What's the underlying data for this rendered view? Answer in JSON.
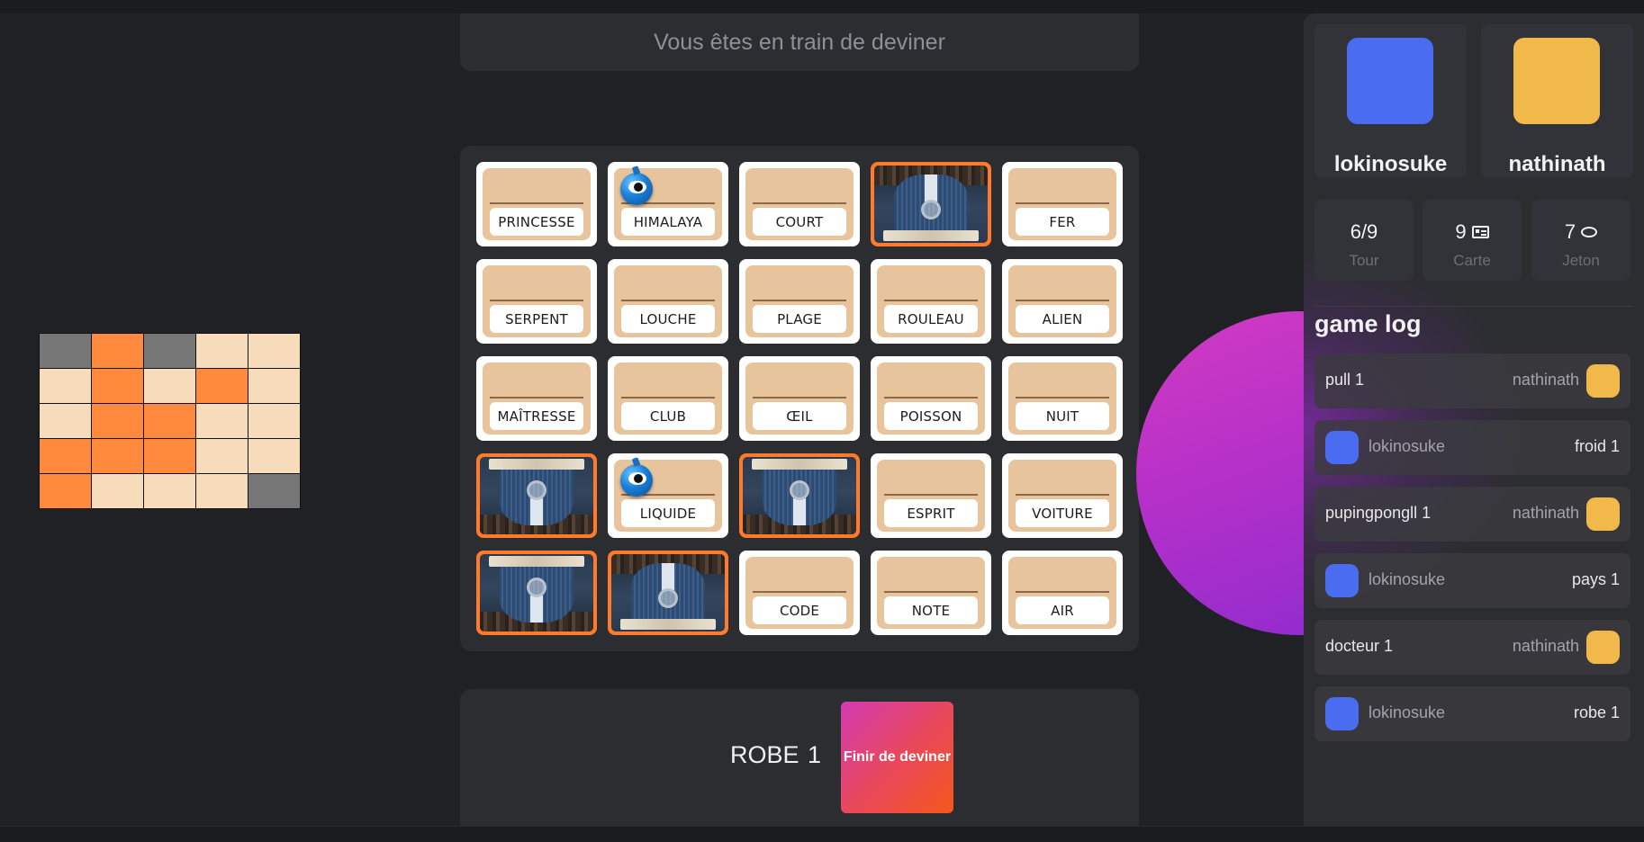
{
  "status": {
    "text": "Vous êtes en train de deviner"
  },
  "colors": {
    "orange": "#ff8a3d",
    "beige": "#f6dcbb",
    "gray": "#777777",
    "blue_team": "#4a6cf0",
    "yellow_team": "#f1b94a",
    "accent_gradient": [
      "#d23bb2",
      "#f4571c"
    ],
    "purple": "#b430c8"
  },
  "key_map": {
    "rows": [
      [
        "gray",
        "orange",
        "gray",
        "beige",
        "beige"
      ],
      [
        "beige",
        "orange",
        "beige",
        "orange",
        "beige"
      ],
      [
        "beige",
        "orange",
        "orange",
        "beige",
        "beige"
      ],
      [
        "orange",
        "orange",
        "orange",
        "beige",
        "beige"
      ],
      [
        "orange",
        "beige",
        "beige",
        "beige",
        "gray"
      ]
    ]
  },
  "board": {
    "cards": [
      {
        "word": "PRINCESSE",
        "state": "hidden",
        "marked": false
      },
      {
        "word": "HIMALAYA",
        "state": "hidden",
        "marked": true
      },
      {
        "word": "COURT",
        "state": "hidden",
        "marked": false
      },
      {
        "word": "",
        "state": "revealed",
        "marked": false,
        "flip": false
      },
      {
        "word": "FER",
        "state": "hidden",
        "marked": false
      },
      {
        "word": "SERPENT",
        "state": "hidden",
        "marked": false
      },
      {
        "word": "LOUCHE",
        "state": "hidden",
        "marked": false
      },
      {
        "word": "PLAGE",
        "state": "hidden",
        "marked": false
      },
      {
        "word": "ROULEAU",
        "state": "hidden",
        "marked": false
      },
      {
        "word": "ALIEN",
        "state": "hidden",
        "marked": false
      },
      {
        "word": "MAÎTRESSE",
        "state": "hidden",
        "marked": false
      },
      {
        "word": "CLUB",
        "state": "hidden",
        "marked": false
      },
      {
        "word": "ŒIL",
        "state": "hidden",
        "marked": false
      },
      {
        "word": "POISSON",
        "state": "hidden",
        "marked": false
      },
      {
        "word": "NUIT",
        "state": "hidden",
        "marked": false
      },
      {
        "word": "",
        "state": "revealed",
        "marked": false,
        "flip": true
      },
      {
        "word": "LIQUIDE",
        "state": "hidden",
        "marked": true
      },
      {
        "word": "",
        "state": "revealed",
        "marked": false,
        "flip": true
      },
      {
        "word": "ESPRIT",
        "state": "hidden",
        "marked": false
      },
      {
        "word": "VOITURE",
        "state": "hidden",
        "marked": false
      },
      {
        "word": "",
        "state": "revealed",
        "marked": false,
        "flip": true
      },
      {
        "word": "",
        "state": "revealed",
        "marked": false,
        "flip": false
      },
      {
        "word": "CODE",
        "state": "hidden",
        "marked": false
      },
      {
        "word": "NOTE",
        "state": "hidden",
        "marked": false
      },
      {
        "word": "AIR",
        "state": "hidden",
        "marked": false
      }
    ]
  },
  "action": {
    "clue_word": "ROBE",
    "clue_number": "1",
    "finish_label": "Finir de deviner"
  },
  "players": [
    {
      "name": "lokinosuke",
      "color": "#4a6cf0"
    },
    {
      "name": "nathinath",
      "color": "#f1b94a"
    }
  ],
  "stats": [
    {
      "value": "6/9",
      "label": "Tour",
      "icon": ""
    },
    {
      "value": "9",
      "label": "Carte",
      "icon": "card-icon"
    },
    {
      "value": "7",
      "label": "Jeton",
      "icon": "coin-icon"
    }
  ],
  "game_log": {
    "title": "game log",
    "entries": [
      {
        "clue": "pull 1",
        "player": "nathinath",
        "side": "right",
        "color": "#f1b94a"
      },
      {
        "clue": "froid 1",
        "player": "lokinosuke",
        "side": "left",
        "color": "#4a6cf0"
      },
      {
        "clue": "pupingpongll 1",
        "player": "nathinath",
        "side": "right",
        "color": "#f1b94a"
      },
      {
        "clue": "pays 1",
        "player": "lokinosuke",
        "side": "left",
        "color": "#4a6cf0"
      },
      {
        "clue": "docteur 1",
        "player": "nathinath",
        "side": "right",
        "color": "#f1b94a"
      },
      {
        "clue": "robe 1",
        "player": "lokinosuke",
        "side": "left",
        "color": "#4a6cf0"
      }
    ]
  }
}
